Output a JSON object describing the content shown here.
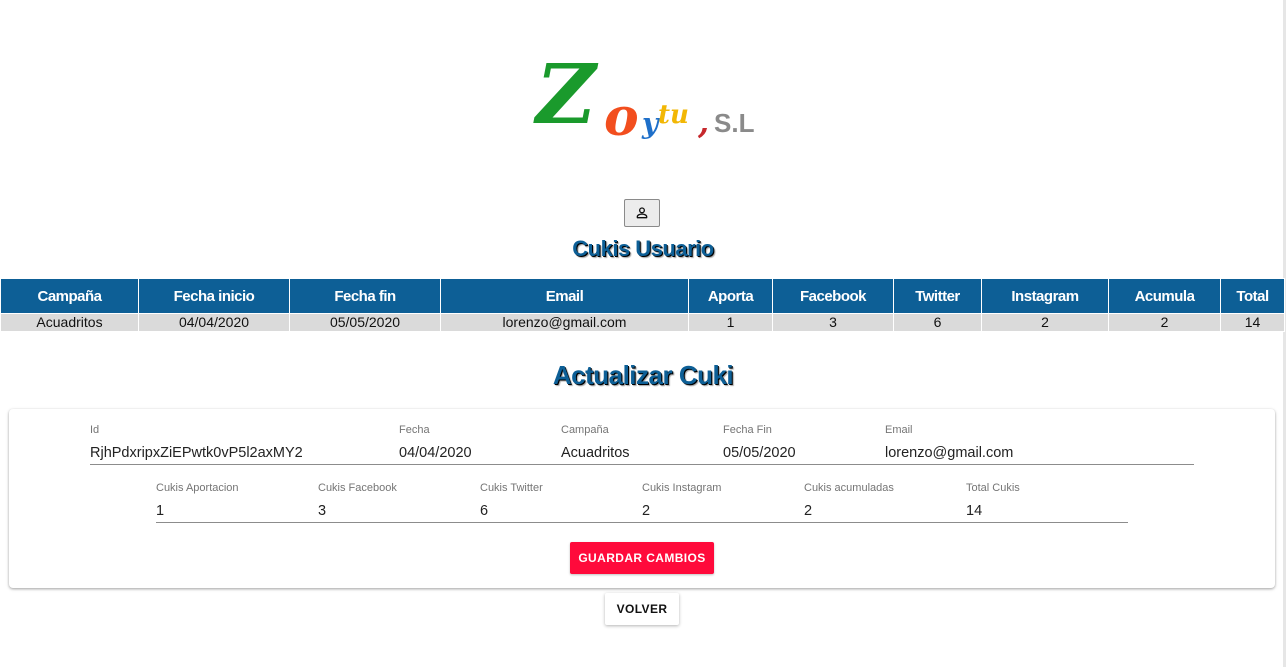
{
  "logo": {
    "z": "Z",
    "o": "o",
    "y": "y",
    "tu": "tu",
    "comma": ",",
    "sl": "S.L"
  },
  "page": {
    "user_section_title": "Cukis Usuario",
    "update_section_title": "Actualizar Cuki"
  },
  "table": {
    "headers": [
      "Campaña",
      "Fecha inicio",
      "Fecha fin",
      "Email",
      "Aporta",
      "Facebook",
      "Twitter",
      "Instagram",
      "Acumula",
      "Total"
    ],
    "rows": [
      [
        "Acuadritos",
        "04/04/2020",
        "05/05/2020",
        "lorenzo@gmail.com",
        "1",
        "3",
        "6",
        "2",
        "2",
        "14"
      ]
    ]
  },
  "form": {
    "id": {
      "label": "Id",
      "value": "RjhPdxripxZiEPwtk0vP5l2axMY2"
    },
    "fecha": {
      "label": "Fecha",
      "value": "04/04/2020"
    },
    "campana": {
      "label": "Campaña",
      "value": "Acuadritos"
    },
    "fecha_fin": {
      "label": "Fecha Fin",
      "value": "05/05/2020"
    },
    "email": {
      "label": "Email",
      "value": "lorenzo@gmail.com"
    },
    "aportacion": {
      "label": "Cukis Aportacion",
      "value": "1"
    },
    "facebook": {
      "label": "Cukis Facebook",
      "value": "3"
    },
    "twitter": {
      "label": "Cukis Twitter",
      "value": "6"
    },
    "instagram": {
      "label": "Cukis Instagram",
      "value": "2"
    },
    "acumuladas": {
      "label": "Cukis acumuladas",
      "value": "2"
    },
    "total": {
      "label": "Total Cukis",
      "value": "14"
    }
  },
  "buttons": {
    "save_label": "GUARDAR CAMBIOS",
    "back_label": "VOLVER"
  },
  "icons": {
    "user_button_icon": "person-icon"
  },
  "colors": {
    "primary_blue": "#0d5f96",
    "save_red": "#ff0a3b",
    "row_gray": "#dadada"
  }
}
